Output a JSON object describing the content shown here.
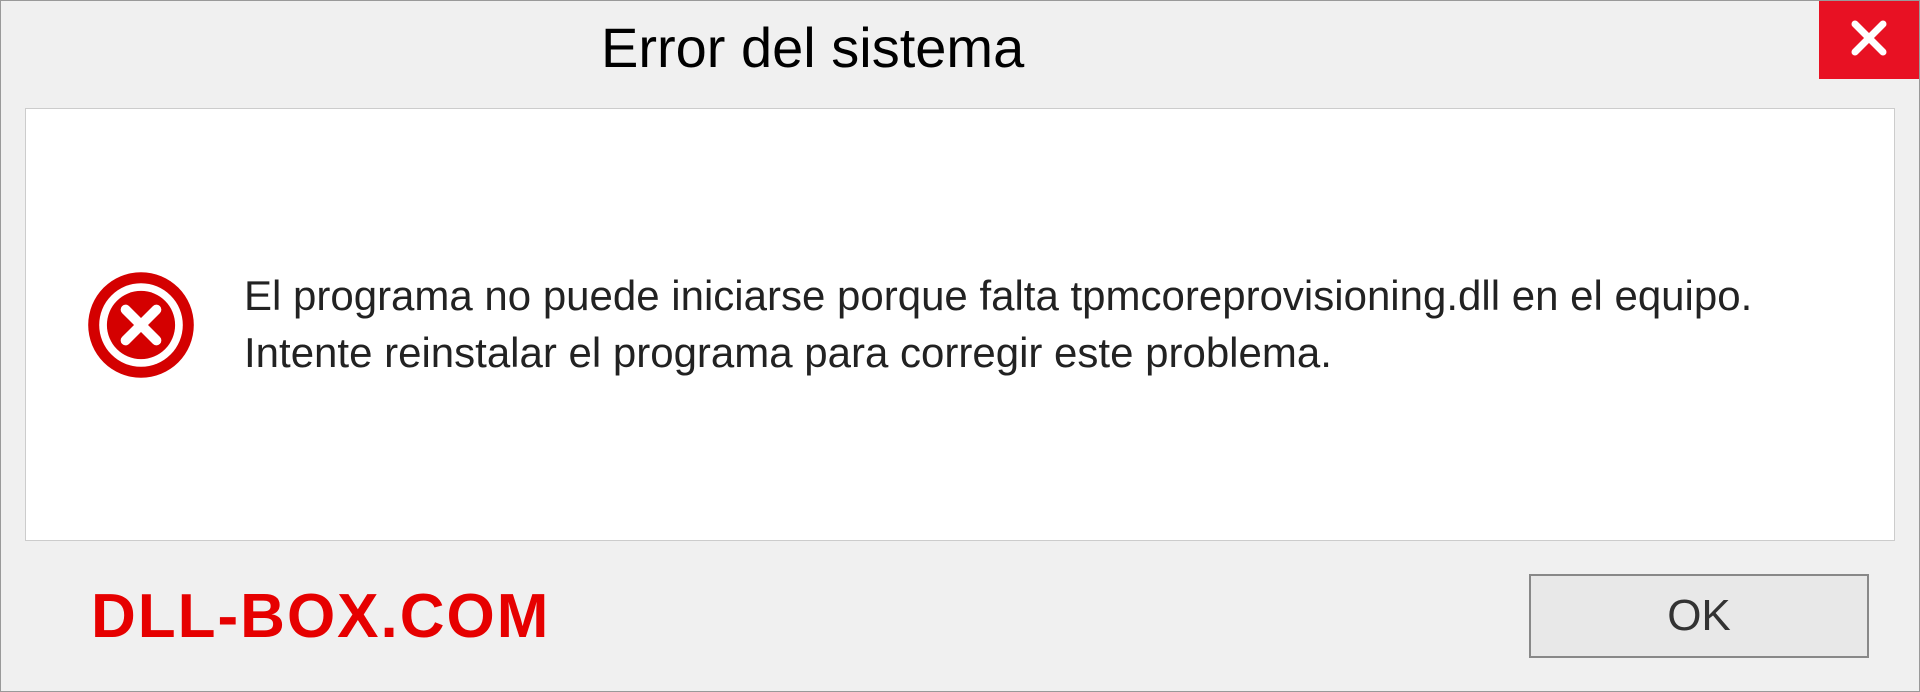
{
  "dialog": {
    "title": "Error del sistema",
    "message": "El programa no puede iniciarse porque falta tpmcoreprovisioning.dll en el equipo. Intente reinstalar el programa para corregir este problema.",
    "ok_label": "OK"
  },
  "brand": {
    "text": "DLL-BOX.COM"
  },
  "colors": {
    "close_bg": "#e81123",
    "error_icon": "#d40000",
    "brand_color": "#e60000"
  }
}
